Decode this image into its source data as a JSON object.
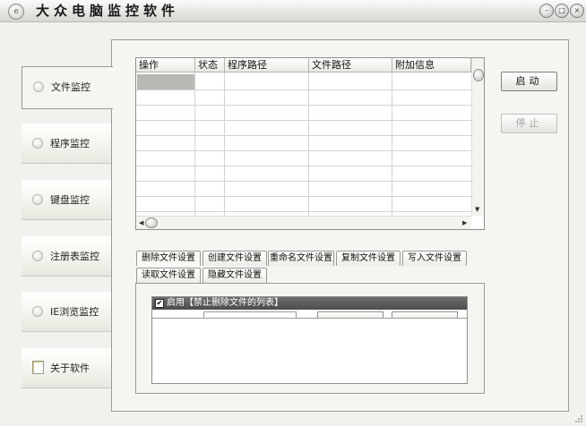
{
  "window": {
    "title": "大众电脑监控软件",
    "icon": "app-icon",
    "controls": [
      "minimize-icon",
      "maximize-icon",
      "close-icon"
    ]
  },
  "sidebar": {
    "items": [
      {
        "label": "文件监控",
        "icon": "radio-dot-icon",
        "active": true
      },
      {
        "label": "程序监控",
        "icon": "radio-dot-icon",
        "active": false
      },
      {
        "label": "键盘监控",
        "icon": "radio-dot-icon",
        "active": false
      },
      {
        "label": "注册表监控",
        "icon": "radio-dot-icon",
        "active": false
      },
      {
        "label": "IE浏览监控",
        "icon": "radio-dot-icon",
        "active": false
      },
      {
        "label": "关于软件",
        "icon": "document-icon",
        "active": false
      }
    ]
  },
  "table": {
    "columns": [
      "操作",
      "状态",
      "程序路径",
      "文件路径",
      "附加信息"
    ],
    "rows": []
  },
  "buttons": {
    "start": "启动",
    "stop": "停止"
  },
  "tabs": {
    "row1": [
      "删除文件设置",
      "创建文件设置",
      "重命名文件设置",
      "复制文件设置",
      "写入文件设置"
    ],
    "row2": [
      "读取文件设置",
      "隐藏文件设置"
    ],
    "active": "删除文件设置"
  },
  "settings": {
    "enable_label": "启用【禁止删除文件的列表】",
    "enable_checked": true
  },
  "colors": {
    "window_bg": "#f1f1ee",
    "header_bar": "#5a5a5a",
    "selection": "#b8b8b4"
  }
}
